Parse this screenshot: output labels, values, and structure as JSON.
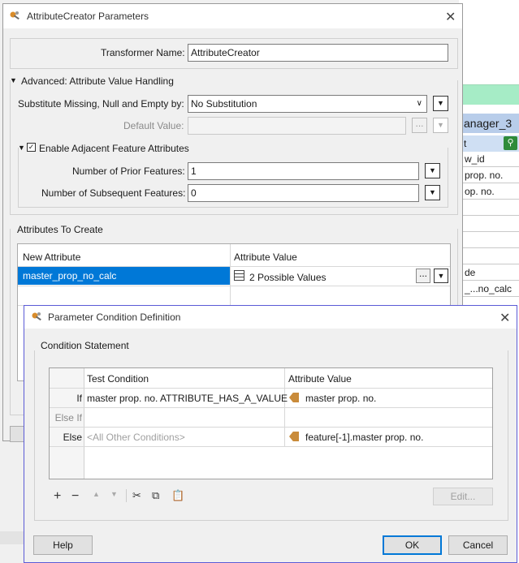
{
  "background": {
    "header_text": "anager_3",
    "sub_header": "t",
    "rows": [
      "w_id",
      "prop. no.",
      "op. no.",
      "",
      "",
      "",
      "",
      "de",
      "_...no_calc"
    ]
  },
  "dialog1": {
    "title": "AttributeCreator Parameters",
    "transformer_name_label": "Transformer Name:",
    "transformer_name_value": "AttributeCreator",
    "advanced_section": "Advanced: Attribute Value Handling",
    "substitute_label": "Substitute Missing, Null and Empty by:",
    "substitute_value": "No Substitution",
    "default_value_label": "Default Value:",
    "default_value_value": "",
    "adjacent_section": "Enable Adjacent Feature Attributes",
    "prior_label": "Number of Prior Features:",
    "prior_value": "1",
    "subsequent_label": "Number of Subsequent Features:",
    "subsequent_value": "0",
    "attributes_section": "Attributes To Create",
    "col_new_attribute": "New Attribute",
    "col_attribute_value": "Attribute Value",
    "row_attribute": "master_prop_no_calc",
    "row_value": "2 Possible Values",
    "ellipsis": "..."
  },
  "dialog2": {
    "title": "Parameter Condition Definition",
    "section": "Condition Statement",
    "col_test_condition": "Test Condition",
    "col_attribute_value": "Attribute Value",
    "rows": [
      {
        "label": "If",
        "condition": "master prop. no. ATTRIBUTE_HAS_A_VALUE",
        "value": "master prop. no."
      },
      {
        "label": "Else If",
        "condition": "",
        "value": ""
      },
      {
        "label": "Else",
        "condition": "<All Other Conditions>",
        "value": "feature[-1].master prop. no."
      }
    ],
    "edit_button": "Edit...",
    "help_button": "Help",
    "ok_button": "OK",
    "cancel_button": "Cancel"
  },
  "colors": {
    "selection": "#0078d7",
    "accent_border": "#5b5bd6",
    "green_bar": "#a6ecc6"
  }
}
